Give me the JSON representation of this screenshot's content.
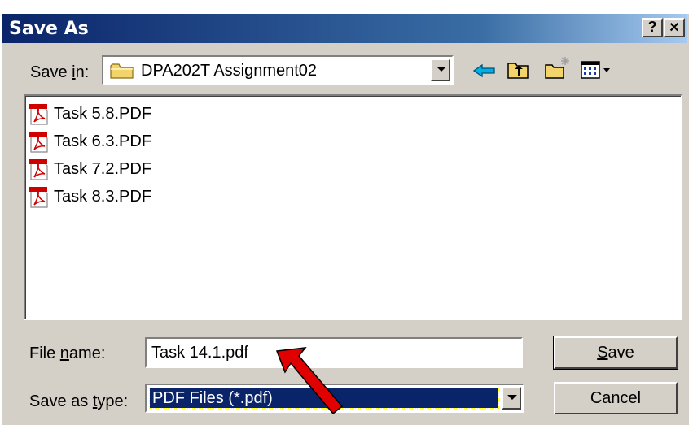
{
  "window": {
    "title": "Save As",
    "help_glyph": "?",
    "close_glyph": "✕"
  },
  "save_in": {
    "label_pre": "Save ",
    "label_key": "i",
    "label_post": "n:",
    "folder": "DPA202T Assignment02"
  },
  "toolbar": {
    "icons": [
      "back-arrow-icon",
      "up-folder-icon",
      "new-folder-icon",
      "view-menu-icon"
    ]
  },
  "files": [
    {
      "name": "Task 5.8.PDF",
      "icon": "pdf-file-icon"
    },
    {
      "name": "Task 6.3.PDF",
      "icon": "pdf-file-icon"
    },
    {
      "name": "Task 7.2.PDF",
      "icon": "pdf-file-icon"
    },
    {
      "name": "Task 8.3.PDF",
      "icon": "pdf-file-icon"
    }
  ],
  "file_name": {
    "label_pre": "File ",
    "label_key": "n",
    "label_post": "ame:",
    "value": "Task 14.1.pdf"
  },
  "save_type": {
    "label_pre": "Save as ",
    "label_key": "t",
    "label_post": "ype:",
    "value": "PDF Files (*.pdf)"
  },
  "buttons": {
    "save_key": "S",
    "save_rest": "ave",
    "cancel": "Cancel"
  },
  "colors": {
    "title_start": "#0a246a",
    "title_end": "#a6caf0",
    "selection": "#0a246a",
    "annotation_arrow": "#e00000"
  }
}
